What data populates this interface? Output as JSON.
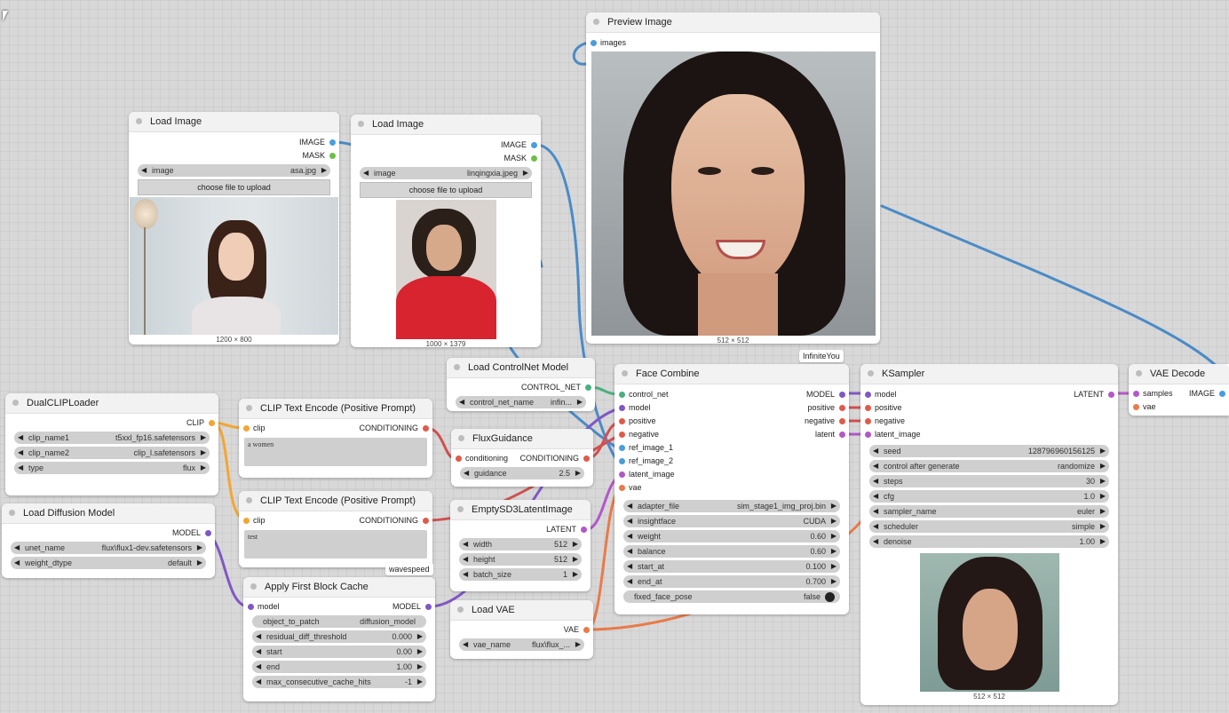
{
  "colors": {
    "image": "#4a9ddc",
    "mask": "#6dbf4b",
    "clip": "#f4a531",
    "conditioning": "#e05a4a",
    "model": "#7f58c4",
    "latent": "#b257c9",
    "vae": "#e97a49",
    "control_net": "#48b07f",
    "link_blue": "#4a8bc7"
  },
  "nodes": {
    "load_image_1": {
      "title": "Load Image",
      "out_image": "IMAGE",
      "out_mask": "MASK",
      "image_label": "image",
      "image_value": "asa.jpg",
      "upload": "choose file to upload",
      "dims": "1200 × 800"
    },
    "load_image_2": {
      "title": "Load Image",
      "out_image": "IMAGE",
      "out_mask": "MASK",
      "image_label": "image",
      "image_value": "linqingxia.jpeg",
      "upload": "choose file to upload",
      "dims": "1000 × 1379"
    },
    "preview_image": {
      "title": "Preview Image",
      "in_images": "images",
      "dims": "512 × 512"
    },
    "load_controlnet": {
      "title": "Load ControlNet Model",
      "out": "CONTROL_NET",
      "w_label": "control_net_name",
      "w_value": "infin..."
    },
    "face_combine": {
      "title": "Face Combine",
      "badge": "InfiniteYou",
      "inputs": [
        "control_net",
        "model",
        "positive",
        "negative",
        "ref_image_1",
        "ref_image_2",
        "latent_image",
        "vae"
      ],
      "outputs": [
        "MODEL",
        "positive",
        "negative",
        "latent"
      ],
      "widgets": [
        {
          "label": "adapter_file",
          "value": "sim_stage1_img_proj.bin"
        },
        {
          "label": "insightface",
          "value": "CUDA"
        },
        {
          "label": "weight",
          "value": "0.60"
        },
        {
          "label": "balance",
          "value": "0.60"
        },
        {
          "label": "start_at",
          "value": "0.100"
        },
        {
          "label": "end_at",
          "value": "0.700"
        }
      ],
      "toggle_label": "fixed_face_pose",
      "toggle_value": "false"
    },
    "ksampler": {
      "title": "KSampler",
      "inputs": [
        "model",
        "positive",
        "negative",
        "latent_image"
      ],
      "out": "LATENT",
      "widgets": [
        {
          "label": "seed",
          "value": "128796960156125"
        },
        {
          "label": "control after generate",
          "value": "randomize"
        },
        {
          "label": "steps",
          "value": "30"
        },
        {
          "label": "cfg",
          "value": "1.0"
        },
        {
          "label": "sampler_name",
          "value": "euler"
        },
        {
          "label": "scheduler",
          "value": "simple"
        },
        {
          "label": "denoise",
          "value": "1.00"
        }
      ],
      "dims": "512 × 512"
    },
    "vae_decode": {
      "title": "VAE Decode",
      "in_samples": "samples",
      "in_vae": "vae",
      "out": "IMAGE"
    },
    "dualclip": {
      "title": "DualCLIPLoader",
      "out": "CLIP",
      "widgets": [
        {
          "label": "clip_name1",
          "value": "t5xxl_fp16.safetensors"
        },
        {
          "label": "clip_name2",
          "value": "clip_l.safetensors"
        },
        {
          "label": "type",
          "value": "flux"
        }
      ]
    },
    "clip_pos": {
      "title": "CLIP Text Encode (Positive Prompt)",
      "in": "clip",
      "out": "CONDITIONING",
      "text": "a women"
    },
    "clip_neg": {
      "title": "CLIP Text Encode (Positive Prompt)",
      "in": "clip",
      "out": "CONDITIONING",
      "text": "test",
      "badge": "wavespeed"
    },
    "flux_guidance": {
      "title": "FluxGuidance",
      "in": "conditioning",
      "out": "CONDITIONING",
      "w_label": "guidance",
      "w_value": "2.5"
    },
    "empty_latent": {
      "title": "EmptySD3LatentImage",
      "out": "LATENT",
      "widgets": [
        {
          "label": "width",
          "value": "512"
        },
        {
          "label": "height",
          "value": "512"
        },
        {
          "label": "batch_size",
          "value": "1"
        }
      ]
    },
    "load_diffusion": {
      "title": "Load Diffusion Model",
      "out": "MODEL",
      "widgets": [
        {
          "label": "unet_name",
          "value": "flux\\flux1-dev.safetensors"
        },
        {
          "label": "weight_dtype",
          "value": "default"
        }
      ]
    },
    "first_block_cache": {
      "title": "Apply First Block Cache",
      "in": "model",
      "out": "MODEL",
      "w0_label": "object_to_patch",
      "w0_value": "diffusion_model",
      "widgets": [
        {
          "label": "residual_diff_threshold",
          "value": "0.000"
        },
        {
          "label": "start",
          "value": "0.00"
        },
        {
          "label": "end",
          "value": "1.00"
        },
        {
          "label": "max_consecutive_cache_hits",
          "value": "-1"
        }
      ]
    },
    "load_vae": {
      "title": "Load VAE",
      "out": "VAE",
      "w_label": "vae_name",
      "w_value": "flux\\flux_..."
    }
  }
}
